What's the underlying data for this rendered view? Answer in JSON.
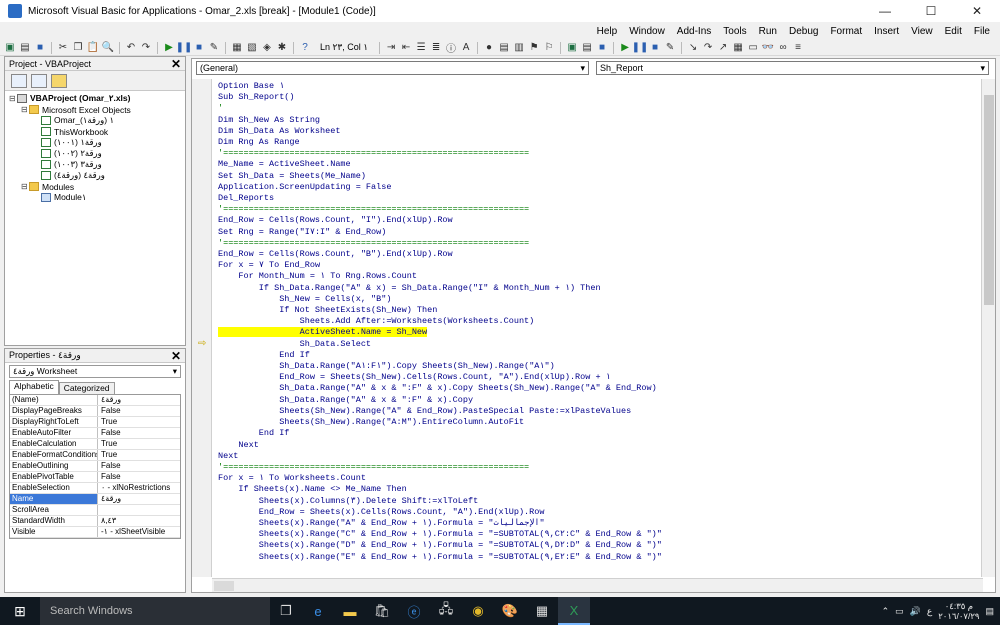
{
  "window": {
    "title": "Microsoft Visual Basic for Applications - Omar_2.xls [break] - [Module1 (Code)]",
    "minimize": "—",
    "maximize": "☐",
    "close": "✕"
  },
  "menu": [
    {
      "label": "File"
    },
    {
      "label": "Edit"
    },
    {
      "label": "View"
    },
    {
      "label": "Insert"
    },
    {
      "label": "Format"
    },
    {
      "label": "Debug"
    },
    {
      "label": "Run"
    },
    {
      "label": "Tools"
    },
    {
      "label": "Add-Ins"
    },
    {
      "label": "Window"
    },
    {
      "label": "Help"
    }
  ],
  "toolbar": {
    "lncol": "Ln ٢٣, Col ١"
  },
  "project": {
    "title": "Project - VBAProject",
    "close": "✕",
    "tree": [
      {
        "label": "VBAProject (Omar_٢.xls)",
        "level": 0,
        "icon": "proj",
        "exp": "⊟",
        "bold": true
      },
      {
        "label": "Microsoft Excel Objects",
        "level": 1,
        "icon": "folder",
        "exp": "⊟"
      },
      {
        "label": "Omar_١ (ورقة١)",
        "level": 2,
        "icon": "sheet",
        "exp": ""
      },
      {
        "label": "ThisWorkbook",
        "level": 2,
        "icon": "sheet",
        "exp": ""
      },
      {
        "label": "ورقة١ (١٠٠١)",
        "level": 2,
        "icon": "sheet",
        "exp": ""
      },
      {
        "label": "ورقة٢ (١٠٠٢)",
        "level": 2,
        "icon": "sheet",
        "exp": ""
      },
      {
        "label": "ورقة٣ (١٠٠٣)",
        "level": 2,
        "icon": "sheet",
        "exp": ""
      },
      {
        "label": "ورقة٤ (ورقة٤)",
        "level": 2,
        "icon": "sheet",
        "exp": ""
      },
      {
        "label": "Modules",
        "level": 1,
        "icon": "folder",
        "exp": "⊟"
      },
      {
        "label": "Module١",
        "level": 2,
        "icon": "mod",
        "exp": ""
      }
    ]
  },
  "properties": {
    "title": "Properties - ورقة٤",
    "close": "✕",
    "object": "ورقة٤ Worksheet",
    "tabs": [
      "Alphabetic",
      "Categorized"
    ],
    "rows": [
      {
        "name": "(Name)",
        "value": "ورقة٤"
      },
      {
        "name": "DisplayPageBreaks",
        "value": "False"
      },
      {
        "name": "DisplayRightToLeft",
        "value": "True"
      },
      {
        "name": "EnableAutoFilter",
        "value": "False"
      },
      {
        "name": "EnableCalculation",
        "value": "True"
      },
      {
        "name": "EnableFormatConditionsCalc",
        "value": "True"
      },
      {
        "name": "EnableOutlining",
        "value": "False"
      },
      {
        "name": "EnablePivotTable",
        "value": "False"
      },
      {
        "name": "EnableSelection",
        "value": "٠ - xlNoRestrictions"
      },
      {
        "name": "Name",
        "value": "ورقة٤",
        "selected": true
      },
      {
        "name": "ScrollArea",
        "value": ""
      },
      {
        "name": "StandardWidth",
        "value": "٨,٤٣"
      },
      {
        "name": "Visible",
        "value": "-١ - xlSheetVisible"
      }
    ]
  },
  "code": {
    "object_combo": "(General)",
    "proc_combo": "Sh_Report",
    "lines": [
      {
        "t": "Option Base ١"
      },
      {
        "t": ""
      },
      {
        "t": "Sub Sh_Report()"
      },
      {
        "t": "'"
      },
      {
        "t": "Dim Sh_New As String"
      },
      {
        "t": "Dim Sh_Data As Worksheet"
      },
      {
        "t": "Dim Rng As Range"
      },
      {
        "t": "'============================================================"
      },
      {
        "t": "Me_Name = ActiveSheet.Name"
      },
      {
        "t": "Set Sh_Data = Sheets(Me_Name)"
      },
      {
        "t": "Application.ScreenUpdating = False"
      },
      {
        "t": "Del_Reports"
      },
      {
        "t": "'============================================================"
      },
      {
        "t": "End_Row = Cells(Rows.Count, \"I\").End(xlUp).Row"
      },
      {
        "t": "Set Rng = Range(\"I٧:I\" & End_Row)"
      },
      {
        "t": "'============================================================"
      },
      {
        "t": "End_Row = Cells(Rows.Count, \"B\").End(xlUp).Row"
      },
      {
        "t": "For x = ٧ To End_Row"
      },
      {
        "t": "    For Month_Num = ١ To Rng.Rows.Count"
      },
      {
        "t": "        If Sh_Data.Range(\"A\" & x) = Sh_Data.Range(\"I\" & Month_Num + ١) Then"
      },
      {
        "t": "            Sh_New = Cells(x, \"B\")"
      },
      {
        "t": "            If Not SheetExists(Sh_New) Then"
      },
      {
        "t": "                Sheets.Add After:=Worksheets(Worksheets.Count)"
      },
      {
        "t": "                ActiveSheet.Name = Sh_New",
        "hl": true
      },
      {
        "t": "                Sh_Data.Select"
      },
      {
        "t": "            End If"
      },
      {
        "t": "            Sh_Data.Range(\"A١:F١\").Copy Sheets(Sh_New).Range(\"A١\")"
      },
      {
        "t": "            End_Row = Sheets(Sh_New).Cells(Rows.Count, \"A\").End(xlUp).Row + ١"
      },
      {
        "t": "            Sh_Data.Range(\"A\" & x & \":F\" & x).Copy Sheets(Sh_New).Range(\"A\" & End_Row)"
      },
      {
        "t": "            Sh_Data.Range(\"A\" & x & \":F\" & x).Copy"
      },
      {
        "t": "            Sheets(Sh_New).Range(\"A\" & End_Row).PasteSpecial Paste:=xlPasteValues"
      },
      {
        "t": "            Sheets(Sh_New).Range(\"A:M\").EntireColumn.AutoFit"
      },
      {
        "t": "        End If"
      },
      {
        "t": "    Next"
      },
      {
        "t": "Next"
      },
      {
        "t": "'============================================================"
      },
      {
        "t": "For x = ١ To Worksheets.Count"
      },
      {
        "t": "    If Sheets(x).Name <> Me_Name Then"
      },
      {
        "t": "        Sheets(x).Columns(٣).Delete Shift:=xlToLeft"
      },
      {
        "t": "        End_Row = Sheets(x).Cells(Rows.Count, \"A\").End(xlUp).Row"
      },
      {
        "t": "        Sheets(x).Range(\"A\" & End_Row + ١).Formula = \"الإجماليات\""
      },
      {
        "t": "        Sheets(x).Range(\"C\" & End_Row + ١).Formula = \"=SUBTOTAL(٩,C٢:C\" & End_Row & \")\""
      },
      {
        "t": "        Sheets(x).Range(\"D\" & End_Row + ١).Formula = \"=SUBTOTAL(٩,D٢:D\" & End_Row & \")\""
      },
      {
        "t": "        Sheets(x).Range(\"E\" & End_Row + ١).Formula = \"=SUBTOTAL(٩,E٢:E\" & End_Row & \")\""
      }
    ]
  },
  "taskbar": {
    "search": "Search Windows",
    "time": "م ٠٤:٣٥",
    "date": "٢٠١٦/٠٧/٢٩",
    "lang": "ع"
  }
}
